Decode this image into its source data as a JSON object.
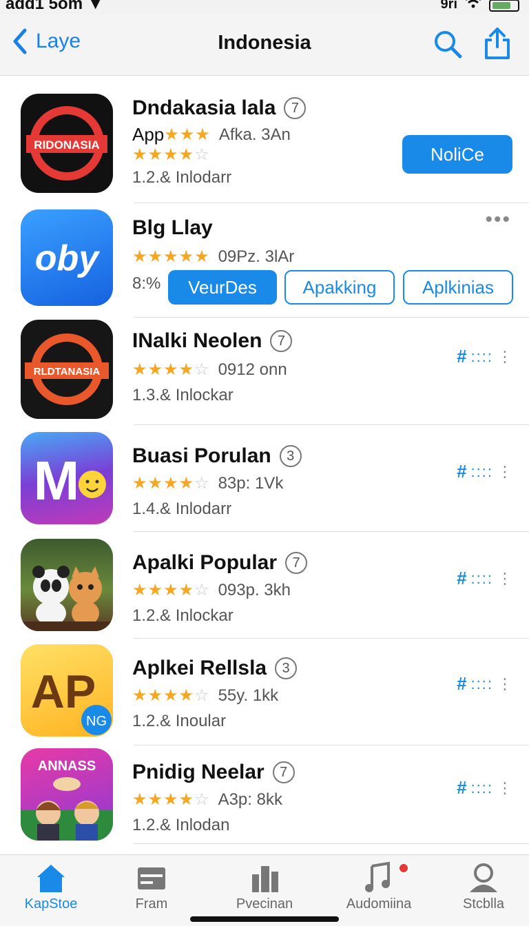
{
  "status_bar": {
    "left": "add1 5om ▼",
    "right": "9ri"
  },
  "nav": {
    "back_label": "Laye",
    "title": "Indonesia"
  },
  "apps": [
    {
      "name": "Dndakasia lala",
      "badge": "7",
      "prefix": "App",
      "meta": "Afka. 3An",
      "rating_stars": 4.5,
      "sub_stars": 4,
      "version": "1.2.& Inlodarr",
      "icon_text": "RIDONASIA",
      "action": "NoliCe"
    },
    {
      "name": "Blg Llay",
      "meta": "09Pz. 3lAr",
      "rating_stars": 5,
      "version": "8:%",
      "icon_text": "oby",
      "buttons": [
        "VeurDes",
        "Apakking",
        "Aplkinias"
      ]
    },
    {
      "name": "INalki Neolen",
      "badge": "7",
      "meta": "0912 onn",
      "rating_stars": 4,
      "version": "1.3.& Inlockar",
      "icon_text": "RLDTANASIA"
    },
    {
      "name": "Buasi Porulan",
      "badge": "3",
      "meta": "83p: 1Vk",
      "rating_stars": 4,
      "version": "1.4.& Inlodarr",
      "icon_text": "M"
    },
    {
      "name": "Apalki Popular",
      "badge": "7",
      "meta": "093p. 3kh",
      "rating_stars": 4,
      "version": "1.2.& Inlockar",
      "icon_text": ""
    },
    {
      "name": "Aplkei Rellsla",
      "badge": "3",
      "meta": "55y. 1kk",
      "rating_stars": 4,
      "version": "1.2.& Inoular",
      "icon_text": "AP",
      "icon_subtext": "NG"
    },
    {
      "name": "Pnidig Neelar",
      "badge": "7",
      "meta": "A3p: 8kk",
      "rating_stars": 4,
      "version": "1.2.& Inlodan",
      "icon_text": "ANNASS"
    }
  ],
  "tabs": [
    {
      "label": "KapStoe",
      "icon": "home-icon",
      "active": true
    },
    {
      "label": "Fram",
      "icon": "card-icon",
      "active": false
    },
    {
      "label": "Pvecinan",
      "icon": "bar-icon",
      "active": false
    },
    {
      "label": "Audomiina",
      "icon": "music-icon",
      "active": false
    },
    {
      "label": "Stcblla",
      "icon": "person-icon",
      "active": false
    }
  ],
  "colors": {
    "accent": "#1a8ae8",
    "star": "#f5a623",
    "badge_red": "#e53935"
  }
}
